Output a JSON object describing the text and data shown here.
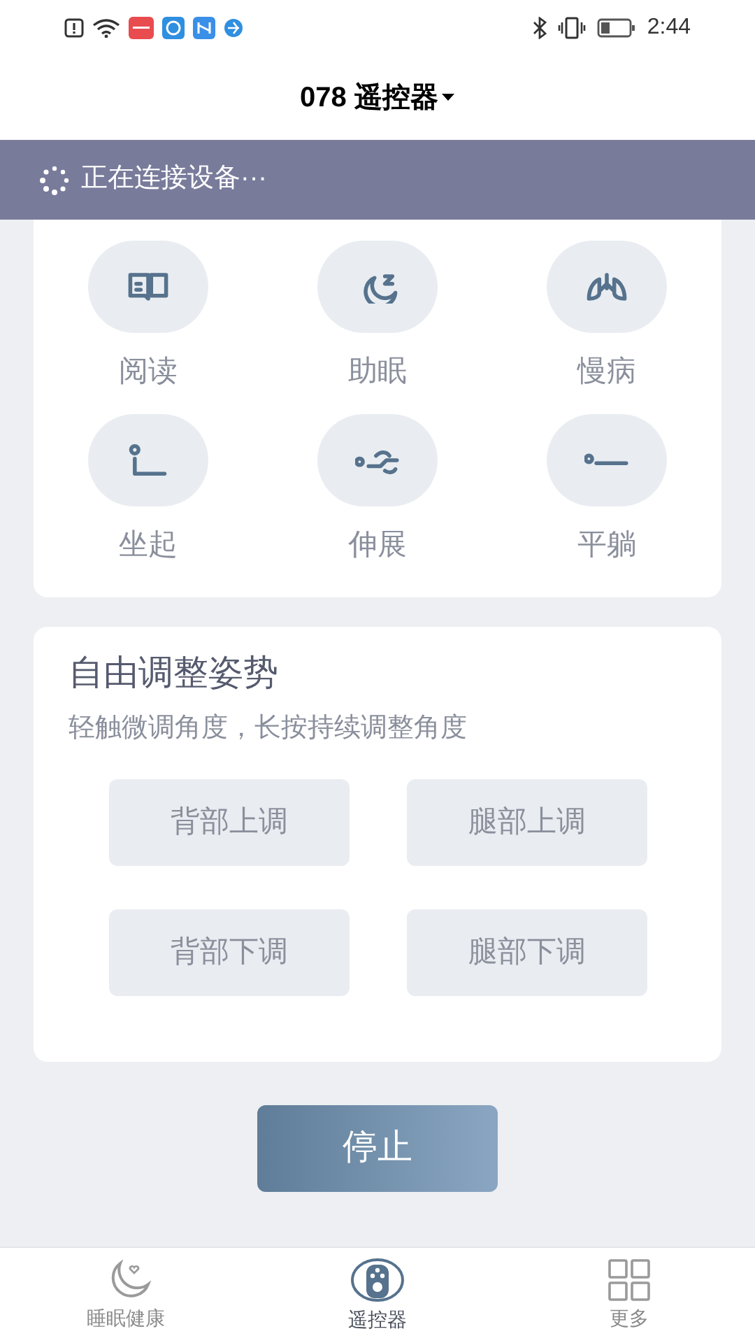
{
  "status_bar": {
    "time": "2:44"
  },
  "header": {
    "title": "078 遥控器"
  },
  "banner": {
    "text": "正在连接设备···"
  },
  "modes": [
    {
      "kind": "read",
      "label": "阅读"
    },
    {
      "kind": "sleep",
      "label": "助眠"
    },
    {
      "kind": "lungs",
      "label": "慢病"
    },
    {
      "kind": "sit",
      "label": "坐起"
    },
    {
      "kind": "stretch",
      "label": "伸展"
    },
    {
      "kind": "flat",
      "label": "平躺"
    }
  ],
  "adjust": {
    "title": "自由调整姿势",
    "subtitle": "轻触微调角度，长按持续调整角度",
    "buttons": [
      "背部上调",
      "腿部上调",
      "背部下调",
      "腿部下调"
    ]
  },
  "stop_button": "停止",
  "bottom_nav": [
    {
      "kind": "moon",
      "label": "睡眠健康",
      "selected": false
    },
    {
      "kind": "remote",
      "label": "遥控器",
      "selected": true
    },
    {
      "kind": "grid",
      "label": "更多",
      "selected": false
    }
  ]
}
